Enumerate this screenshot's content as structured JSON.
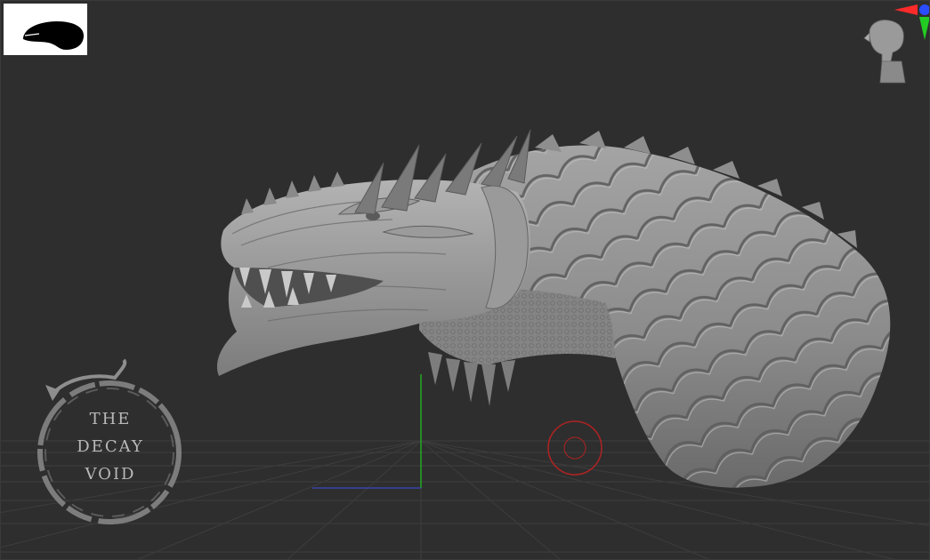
{
  "viewport": {
    "background_color": "#2e2e2e",
    "grid_color": "#3d3d3d",
    "axis_colors": {
      "x": "#ff2a2a",
      "y": "#22cc22",
      "z": "#2a4dff"
    }
  },
  "thumbnail": {
    "icon": "dragon-silhouette-icon"
  },
  "navigation_gizmo": {
    "icon": "head-orientation-gizmo-icon"
  },
  "model": {
    "icon": "sculpted-dragon-head-icon",
    "color": "#8f8f8f"
  },
  "brush_cursor": {
    "color": "#b02323"
  },
  "watermark": {
    "line1": "THE",
    "line2": "DECAY",
    "line3": "VOID",
    "icon": "serpent-ring-icon"
  }
}
